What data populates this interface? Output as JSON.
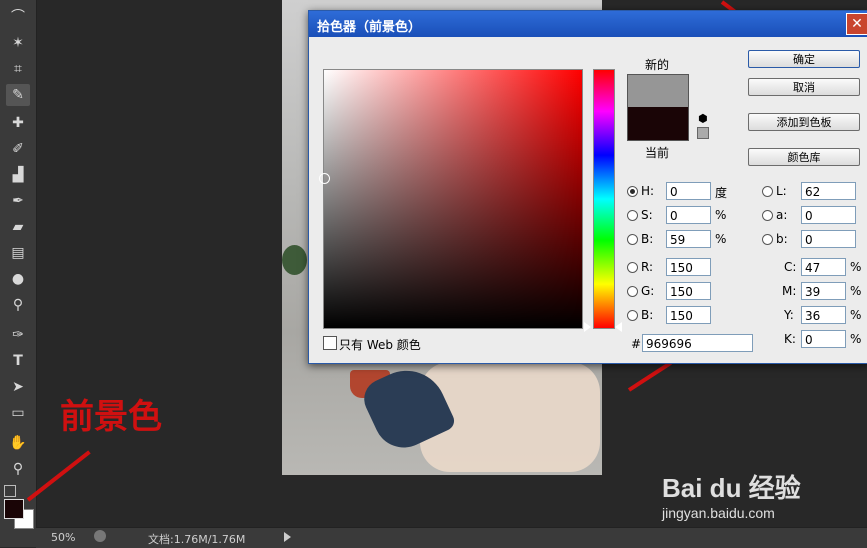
{
  "toolbar": {
    "tools": [
      "lasso-icon",
      "magic-wand-icon",
      "crop-icon",
      "eyedropper-icon",
      "healing-brush-icon",
      "brush-icon",
      "stamp-icon",
      "history-brush-icon",
      "eraser-icon",
      "gradient-icon",
      "blur-icon",
      "dodge-icon",
      "pen-icon",
      "type-icon",
      "path-selection-icon",
      "rectangle-icon",
      "hand-icon",
      "zoom-icon"
    ],
    "type_glyph": "T",
    "foreground_color": "#1a0506",
    "background_color": "#ffffff"
  },
  "annotation": {
    "foreground_label": "前景色",
    "accent": "#d01010"
  },
  "statusbar": {
    "zoom": "50%",
    "doc_info": "文档:1.76M/1.76M"
  },
  "dialog": {
    "title": "拾色器（前景色）",
    "close_glyph": "✕",
    "new_label": "新的",
    "current_label": "当前",
    "new_color": "#969696",
    "current_color": "#1a0506",
    "web_only_label": "只有 Web 颜色",
    "buttons": {
      "ok": "确定",
      "cancel": "取消",
      "add_swatch": "添加到色板",
      "color_library": "颜色库"
    },
    "hsb": [
      {
        "label": "H:",
        "value": "0",
        "unit": "度",
        "selected": true
      },
      {
        "label": "S:",
        "value": "0",
        "unit": "%",
        "selected": false
      },
      {
        "label": "B:",
        "value": "59",
        "unit": "%",
        "selected": false
      }
    ],
    "rgb": [
      {
        "label": "R:",
        "value": "150"
      },
      {
        "label": "G:",
        "value": "150"
      },
      {
        "label": "B:",
        "value": "150"
      }
    ],
    "lab": [
      {
        "label": "L:",
        "value": "62"
      },
      {
        "label": "a:",
        "value": "0"
      },
      {
        "label": "b:",
        "value": "0"
      }
    ],
    "cmyk": [
      {
        "label": "C:",
        "value": "47",
        "unit": "%"
      },
      {
        "label": "M:",
        "value": "39",
        "unit": "%"
      },
      {
        "label": "Y:",
        "value": "36",
        "unit": "%"
      },
      {
        "label": "K:",
        "value": "0",
        "unit": "%"
      }
    ],
    "hex_label": "#",
    "hex_value": "969696"
  },
  "watermark": {
    "brand": "Bai du 经验",
    "url": "jingyan.baidu.com"
  }
}
